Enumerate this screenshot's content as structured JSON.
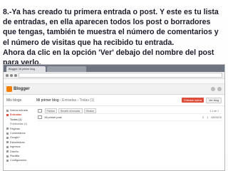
{
  "instructions": {
    "line1": "8.-Ya has creado tu primera entrada o post. Y este es tu lista",
    "line2": "de entradas, en ella aparecen todos los post o borradores",
    "line3": "que tengas, también te muestra el número de comentarios y",
    "line4": "el número de visitas que ha recibido tu entrada.",
    "line5": "Ahora da clic en la opción 'Ver' debajo del nombre del post",
    "line6": "para verlo."
  },
  "screenshot": {
    "tab_active": "Blogger: Mi primer blog",
    "brand": "Blogger",
    "my_blogs": "Mis blogs",
    "blog_title": "Mi primer blog",
    "crumb": "› Entradas › Todas (1)",
    "new_post": "Entrada nueva",
    "view_blog": "Ver blog",
    "sidebar": [
      "Nueva entrada",
      "Entradas",
      "Todas (1)",
      "Publicadas (1)",
      "Páginas",
      "Comentarios",
      "Google+",
      "Estadísticas",
      "Ingresos",
      "Diseño",
      "Plantilla",
      "Configuración"
    ],
    "toolbar": [
      "Publicar",
      "Revertir al borrador",
      "Eliminar"
    ],
    "pager": "1-1 de 1",
    "post_title": "Mi primer post",
    "post_comments": "0",
    "post_views": "1",
    "post_date": "28/05/15"
  }
}
